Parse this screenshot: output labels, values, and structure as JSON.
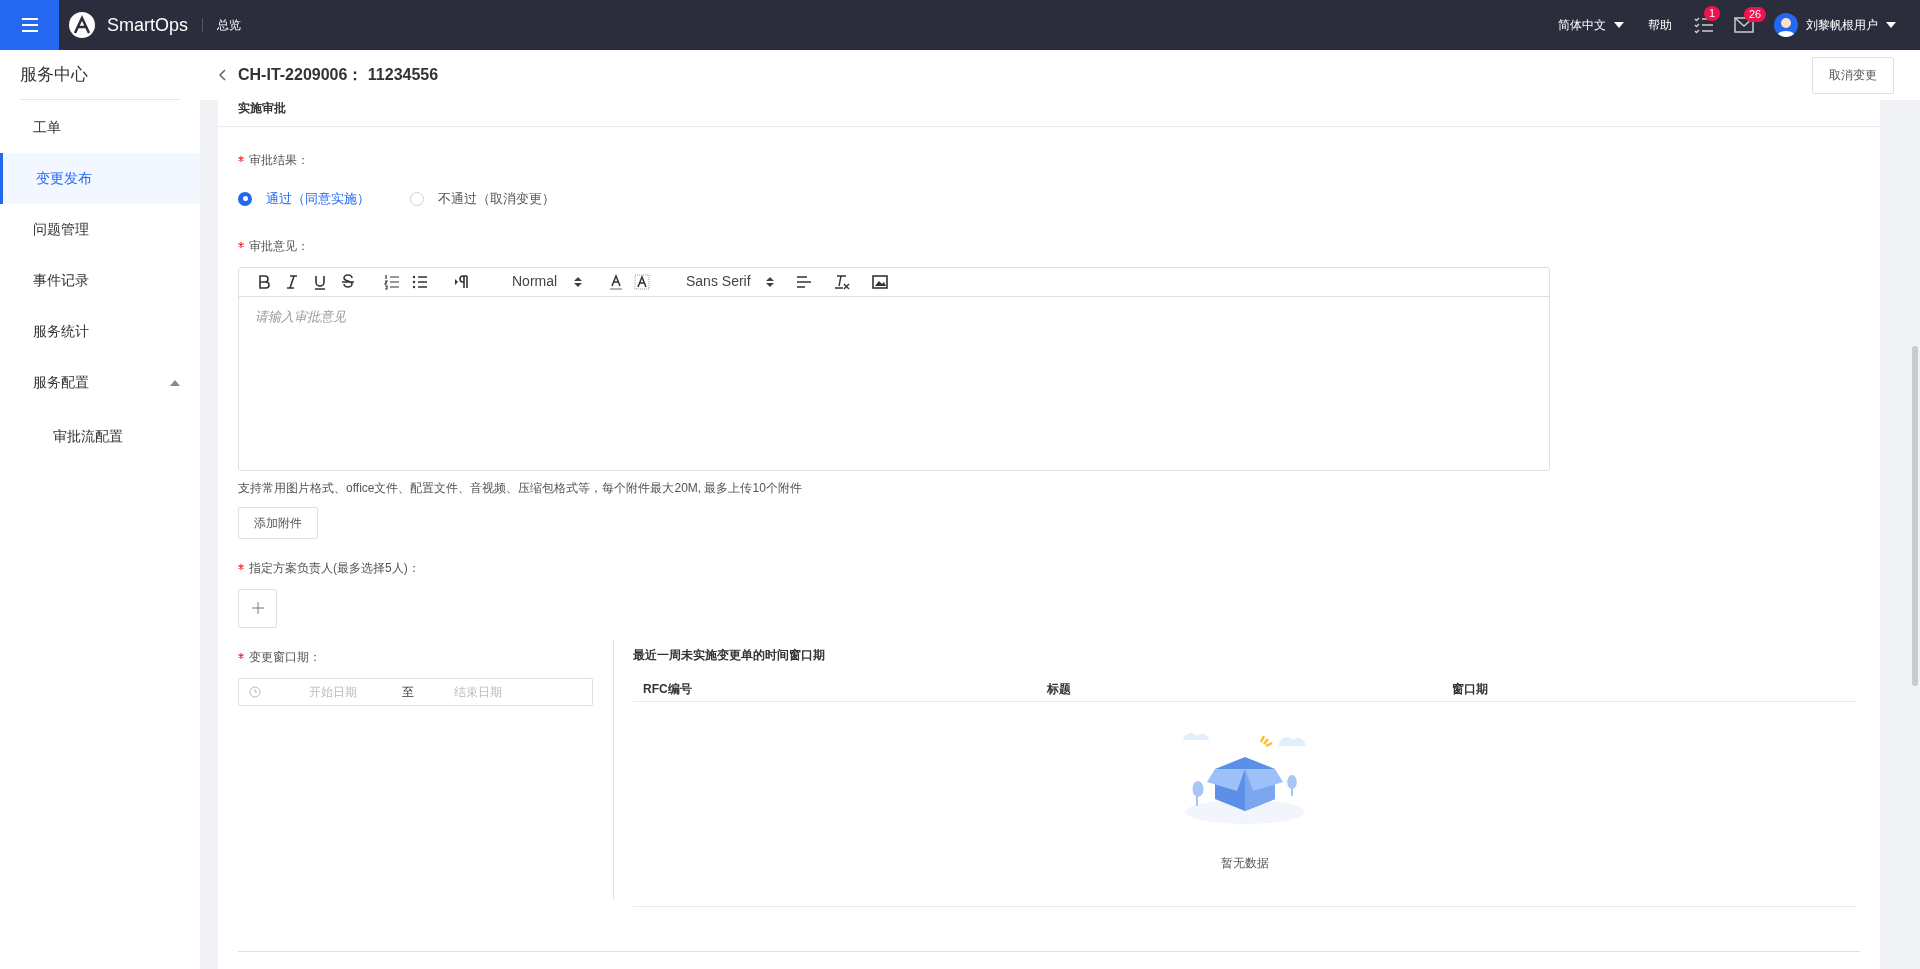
{
  "topbar": {
    "brand": "SmartOps",
    "nav_link": "总览",
    "language": "简体中文",
    "help": "帮助",
    "tasks_badge": "1",
    "mail_badge": "26",
    "user": "刘黎帆根用户"
  },
  "sidebar": {
    "title": "服务中心",
    "items": [
      {
        "label": "工单",
        "selected": false
      },
      {
        "label": "变更发布",
        "selected": true
      },
      {
        "label": "问题管理",
        "selected": false
      },
      {
        "label": "事件记录",
        "selected": false
      },
      {
        "label": "服务统计",
        "selected": false
      },
      {
        "label": "服务配置",
        "selected": false,
        "expanded": true,
        "children": [
          {
            "label": "审批流配置",
            "selected": false
          }
        ]
      }
    ]
  },
  "page": {
    "title": "CH-IT-2209006： 11234556",
    "cancel_button": "取消变更",
    "section_title": "实施审批"
  },
  "form": {
    "result_required": true,
    "opinion_required": true,
    "owner_required": true,
    "window_required": true,
    "result_label": "审批结果：",
    "result_options": [
      {
        "label": "通过（同意实施）",
        "selected": true
      },
      {
        "label": "不通过（取消变更）",
        "selected": false
      }
    ],
    "opinion_label": "审批意见：",
    "header_select": "Normal",
    "font_select": "Sans Serif",
    "opinion_placeholder": "请输入审批意见",
    "attachment_hint": "支持常用图片格式、office文件、配置文件、音视频、压缩包格式等，每个附件最大20M, 最多上传10个附件",
    "attachment_button": "添加附件",
    "owner_label": "指定方案负责人(最多选择5人)：",
    "window_label": "变更窗口期：",
    "start_placeholder": "开始日期",
    "range_separator": "至",
    "end_placeholder": "结束日期"
  },
  "recent": {
    "title": "最近一周未实施变更单的时间窗口期",
    "columns": [
      "RFC编号",
      "标题",
      "窗口期"
    ],
    "empty_text": "暂无数据"
  }
}
